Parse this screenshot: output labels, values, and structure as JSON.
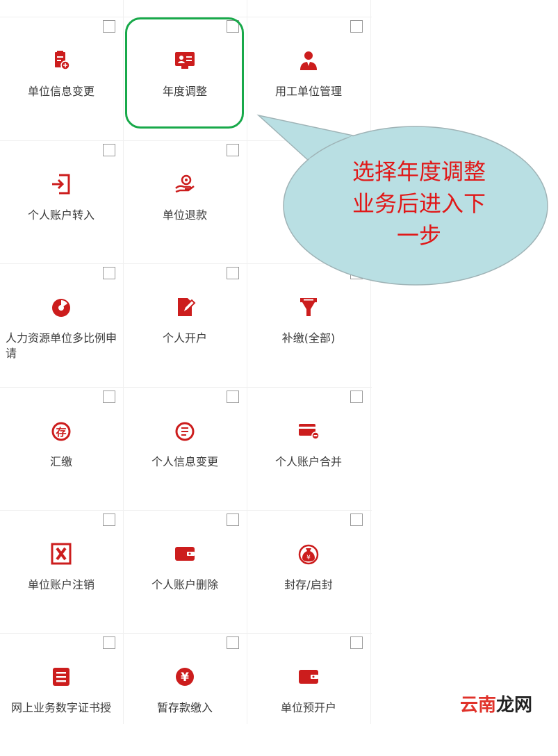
{
  "colors": {
    "icon": "#cc1d1d",
    "highlight": "#18a94a",
    "callout_fill": "#b9dfe3",
    "callout_text": "#e01818"
  },
  "tiles": [
    {
      "label": "单位信息变更",
      "icon": "clipboard-plus-icon"
    },
    {
      "label": "年度调整",
      "icon": "id-card-icon"
    },
    {
      "label": "用工单位管理",
      "icon": "person-icon"
    },
    {
      "label": "个人账户转入",
      "icon": "enter-door-icon"
    },
    {
      "label": "单位退款",
      "icon": "refund-hand-icon"
    },
    {
      "label": "",
      "icon": ""
    },
    {
      "label": "人力资源单位多比例申请",
      "icon": "pie-chart-icon"
    },
    {
      "label": "个人开户",
      "icon": "edit-document-icon"
    },
    {
      "label": "补缴(全部)",
      "icon": "funnel-icon"
    },
    {
      "label": "汇缴",
      "icon": "deposit-icon"
    },
    {
      "label": "个人信息变更",
      "icon": "document-circle-icon"
    },
    {
      "label": "个人账户合并",
      "icon": "card-merge-icon"
    },
    {
      "label": "单位账户注销",
      "icon": "cancel-x-icon"
    },
    {
      "label": "个人账户删除",
      "icon": "wallet-icon"
    },
    {
      "label": "封存/启封",
      "icon": "money-bag-icon"
    },
    {
      "label": "网上业务数字证书授",
      "icon": "list-doc-icon"
    },
    {
      "label": "暂存款缴入",
      "icon": "yen-circle-icon"
    },
    {
      "label": "单位预开户",
      "icon": "wallet-2-icon"
    }
  ],
  "callout": {
    "lines": [
      "选择年度调整",
      "业务后进入下",
      "一步"
    ]
  },
  "watermark": {
    "part1": "云南",
    "part2": "龙网"
  }
}
